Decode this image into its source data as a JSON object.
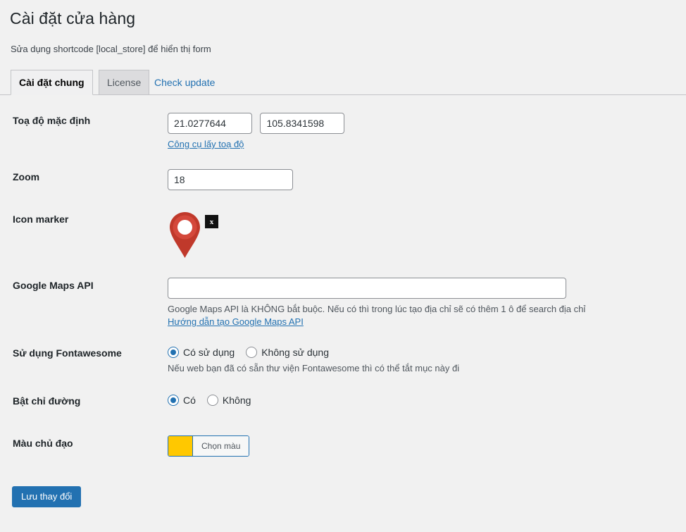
{
  "header": {
    "title": "Cài đặt cửa hàng",
    "subtitle": "Sửa dụng shortcode [local_store] để hiển thị form"
  },
  "tabs": [
    {
      "label": "Cài đặt chung",
      "state": "active"
    },
    {
      "label": "License",
      "state": "inactive"
    },
    {
      "label": "Check update",
      "state": "link"
    }
  ],
  "form": {
    "coordinates": {
      "label": "Toạ độ mặc định",
      "latitude": "21.0277644",
      "longitude": "105.8341598",
      "tool_link": "Công cụ lấy toạ độ"
    },
    "zoom": {
      "label": "Zoom",
      "value": "18"
    },
    "icon_marker": {
      "label": "Icon marker",
      "remove_label": "x",
      "marker_color_outer": "#c0392b",
      "marker_color_inner": "#d63c30"
    },
    "google_maps_api": {
      "label": "Google Maps API",
      "value": "",
      "placeholder": "",
      "description": "Google Maps API là KHÔNG bắt buộc. Nếu có thì trong lúc tạo địa chỉ sẽ có thêm 1 ô để search địa chỉ",
      "guide_link": "Hướng dẫn tạo Google Maps API"
    },
    "fontawesome": {
      "label": "Sử dụng Fontawesome",
      "options": [
        {
          "label": "Có sử dụng",
          "checked": true
        },
        {
          "label": "Không sử dụng",
          "checked": false
        }
      ],
      "description": "Nếu web bạn đã có sẵn thư viện Fontawesome thì có thể tắt mục này đi"
    },
    "direction": {
      "label": "Bật chỉ đường",
      "options": [
        {
          "label": "Có",
          "checked": true
        },
        {
          "label": "Không",
          "checked": false
        }
      ]
    },
    "primary_color": {
      "label": "Màu chủ đạo",
      "button_label": "Chọn màu",
      "value": "#ffc800"
    }
  },
  "submit": {
    "label": "Lưu thay đổi"
  },
  "colors": {
    "accent": "#2271b1",
    "page_background": "#f1f1f1",
    "swatch": "#ffc800"
  }
}
